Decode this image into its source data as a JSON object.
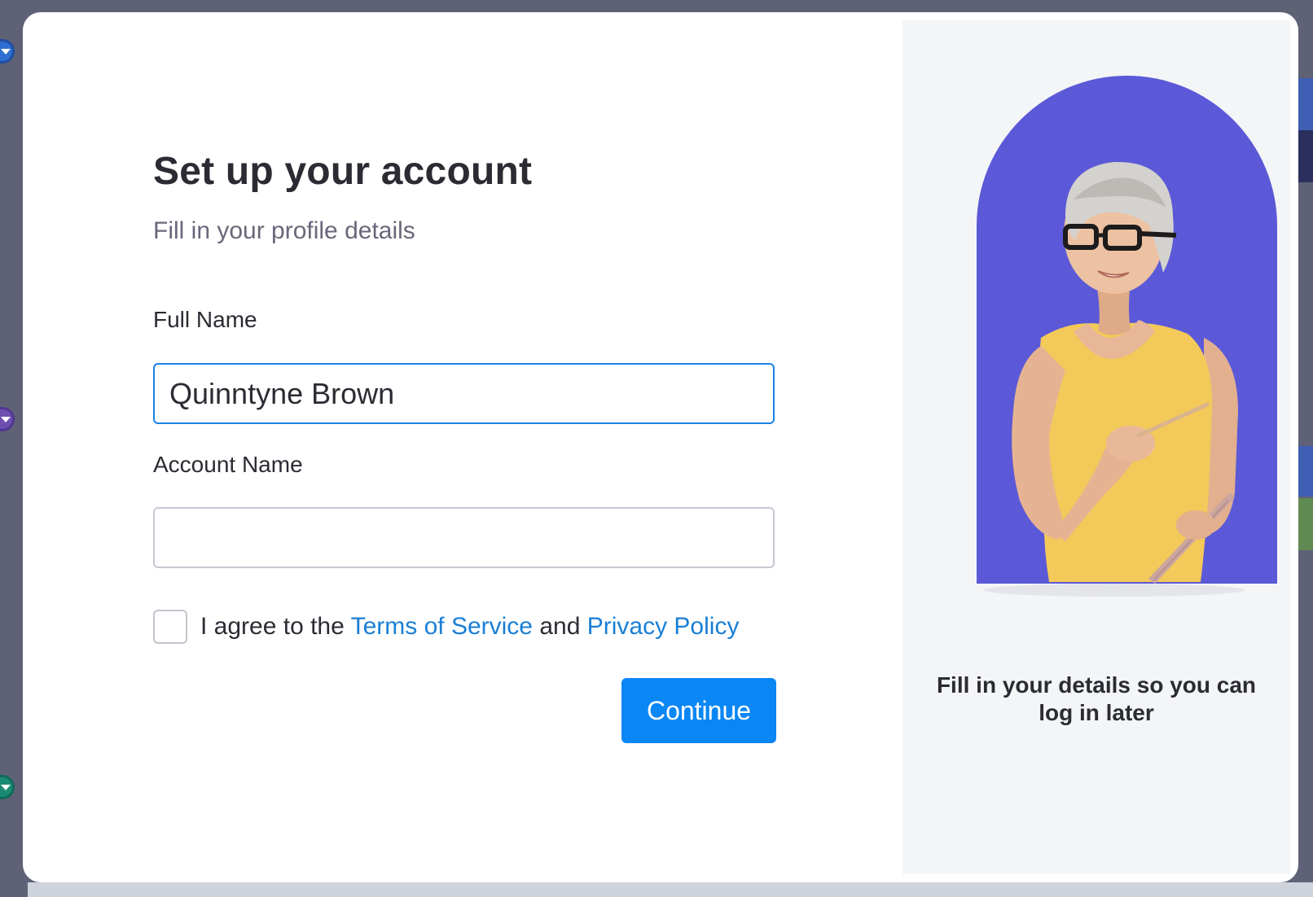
{
  "modal": {
    "title": "Set up your account",
    "subtitle": "Fill in your profile details",
    "full_name": {
      "label": "Full Name",
      "value": "Quinntyne Brown"
    },
    "account_name": {
      "label": "Account Name",
      "value": ""
    },
    "agreement": {
      "checked": false,
      "prefix": "I agree to the",
      "terms_link": "Terms of Service",
      "conjunction": "and",
      "privacy_link": "Privacy Policy"
    },
    "continue_label": "Continue"
  },
  "illustration": {
    "caption": "Fill in your details so you can log in later",
    "arch_color": "#5b59d7",
    "shirt_color": "#f3c95a"
  },
  "colors": {
    "primary": "#0a86f5",
    "link": "#1a7fd6",
    "text": "#2b2c33",
    "muted": "#676879",
    "overlay": "#5f6176"
  }
}
